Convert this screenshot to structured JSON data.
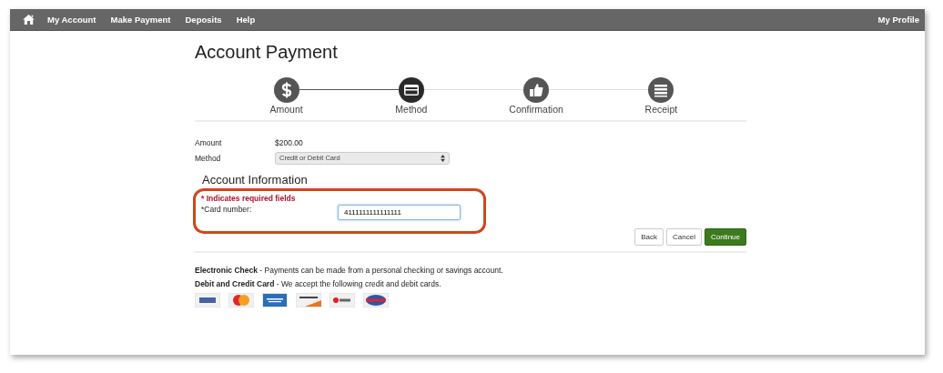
{
  "nav": {
    "items": [
      "My Account",
      "Make Payment",
      "Deposits",
      "Help"
    ],
    "profile": "My Profile"
  },
  "title": "Account Payment",
  "steps": [
    {
      "label": "Amount",
      "kind": "dollar",
      "selected": false
    },
    {
      "label": "Method",
      "kind": "card",
      "selected": true
    },
    {
      "label": "Confirmation",
      "kind": "thumb",
      "selected": false
    },
    {
      "label": "Receipt",
      "kind": "list",
      "selected": false
    }
  ],
  "summary": [
    {
      "label": "Amount",
      "kind": "text",
      "value": "$200.00"
    },
    {
      "label": "Method",
      "kind": "select",
      "value": "Credit or Debit Card"
    }
  ],
  "section_title": "Account Information",
  "required_note": "* Indicates required fields",
  "card_field": {
    "label": "*Card number:",
    "value": "4111111111111111"
  },
  "buttons": [
    {
      "label": "Back",
      "kind": "default"
    },
    {
      "label": "Cancel",
      "kind": "default"
    },
    {
      "label": "Continue",
      "kind": "primary"
    }
  ],
  "info": [
    "**Electronic Check** - Payments can be made from a personal checking or savings  account.",
    "**Debit and Credit Card** - We accept the following credit and debit cards."
  ],
  "cards": [
    {
      "kind": "visa"
    },
    {
      "kind": "mastercard"
    },
    {
      "kind": "amex"
    },
    {
      "kind": "discover"
    },
    {
      "kind": "bc"
    },
    {
      "kind": "diners"
    }
  ]
}
